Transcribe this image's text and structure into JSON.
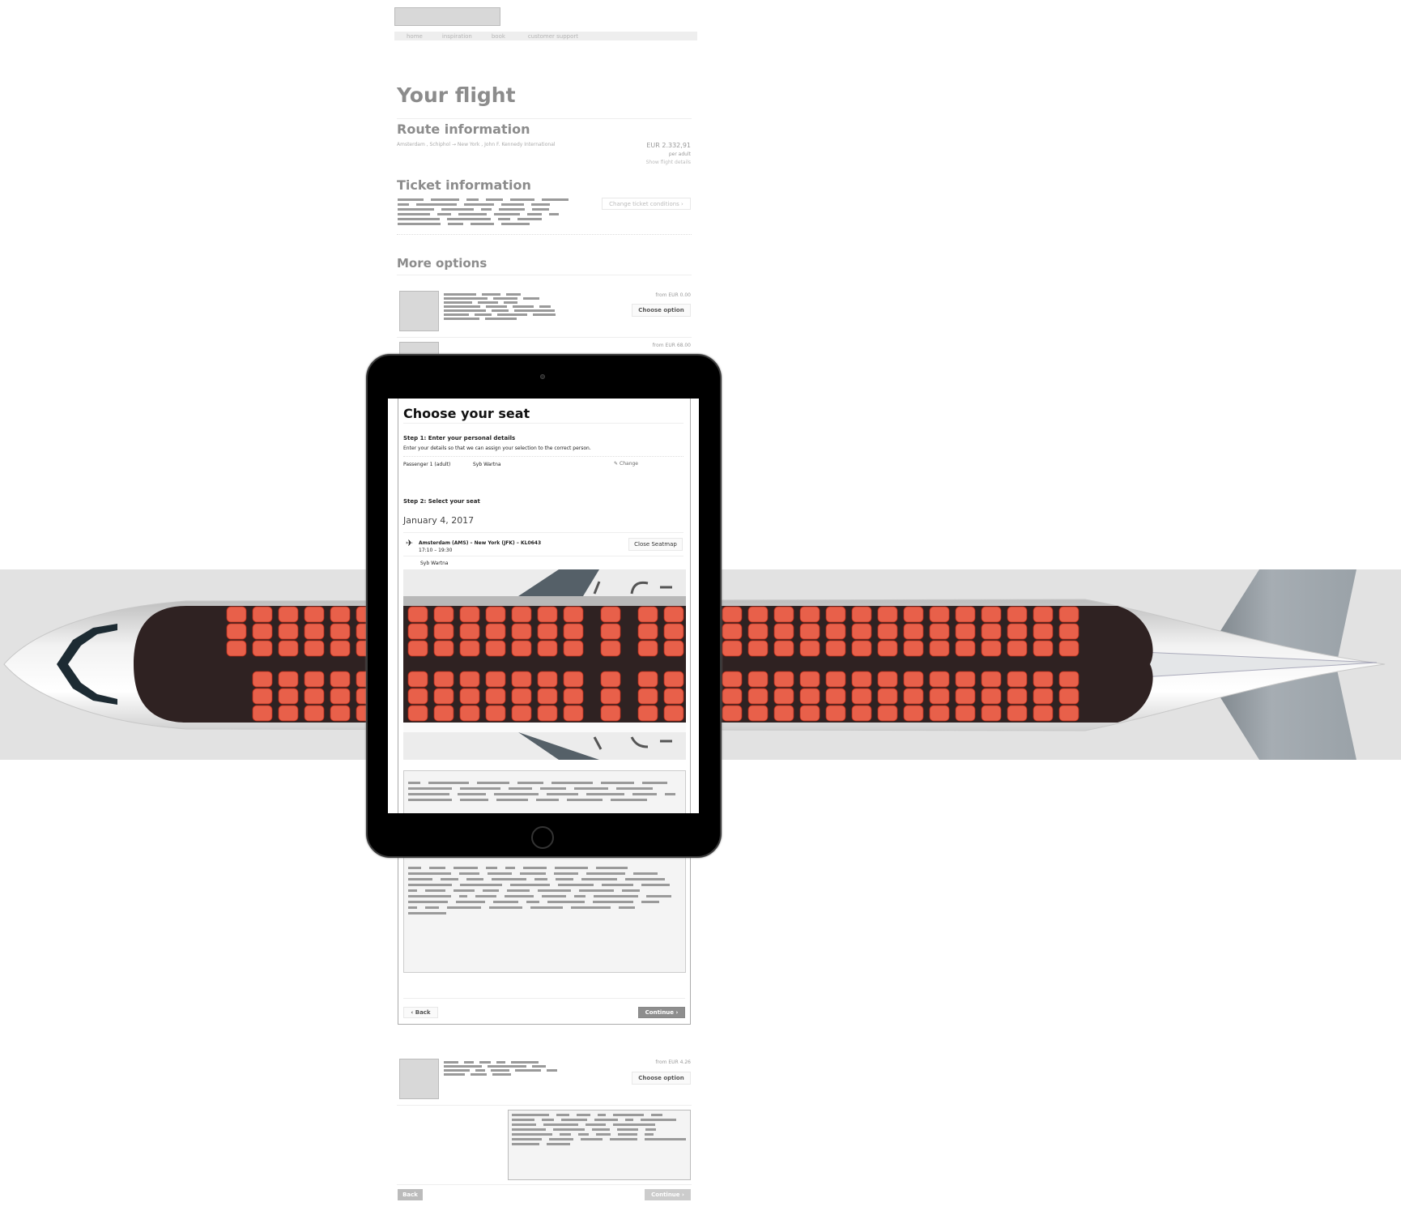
{
  "background_page": {
    "nav": [
      "home",
      "inspiration",
      "book",
      "customer support"
    ],
    "title": "Your flight",
    "route": {
      "heading": "Route information",
      "text": "Amsterdam , Schiphol → New York , John F. Kennedy International",
      "price": "EUR 2.332,91",
      "per": "per adult",
      "details_link": "Show flight details"
    },
    "ticket": {
      "heading": "Ticket information",
      "button": "Change ticket conditions ›"
    },
    "more_options": {
      "heading": "More options",
      "items": [
        {
          "price": "from EUR 0.00",
          "button": "Choose option"
        },
        {
          "price": "from EUR 68.00"
        },
        {
          "price": "from EUR 4.26",
          "button": "Choose option"
        }
      ]
    },
    "footer": {
      "back": "Back",
      "continue": "Continue ›"
    }
  },
  "seat_modal": {
    "title": "Choose your seat",
    "step1": {
      "heading": "Step 1: Enter your personal details",
      "text": "Enter your details so that we can assign your selection to the correct person.",
      "passenger_label": "Passenger 1 (adult)",
      "passenger_name": "Syb Wartna",
      "change": "Change"
    },
    "step2": {
      "heading": "Step 2: Select your seat",
      "date": "January 4, 2017",
      "flight": "Amsterdam (AMS) – New York (JFK) – KL0643",
      "times": "17:10 – 19:30",
      "close_button": "Close Seatmap",
      "passenger": "Syb Wartna"
    },
    "back": "‹ Back",
    "continue": "Continue ›"
  },
  "colors": {
    "seat": "#e8604a",
    "cabin": "#2f2222",
    "tablet": "#000000",
    "muted": "#8c8c8c"
  },
  "icons": [
    "plane-icon",
    "edit-icon",
    "exit-arrow-icon",
    "home-button-icon",
    "camera-icon"
  ]
}
